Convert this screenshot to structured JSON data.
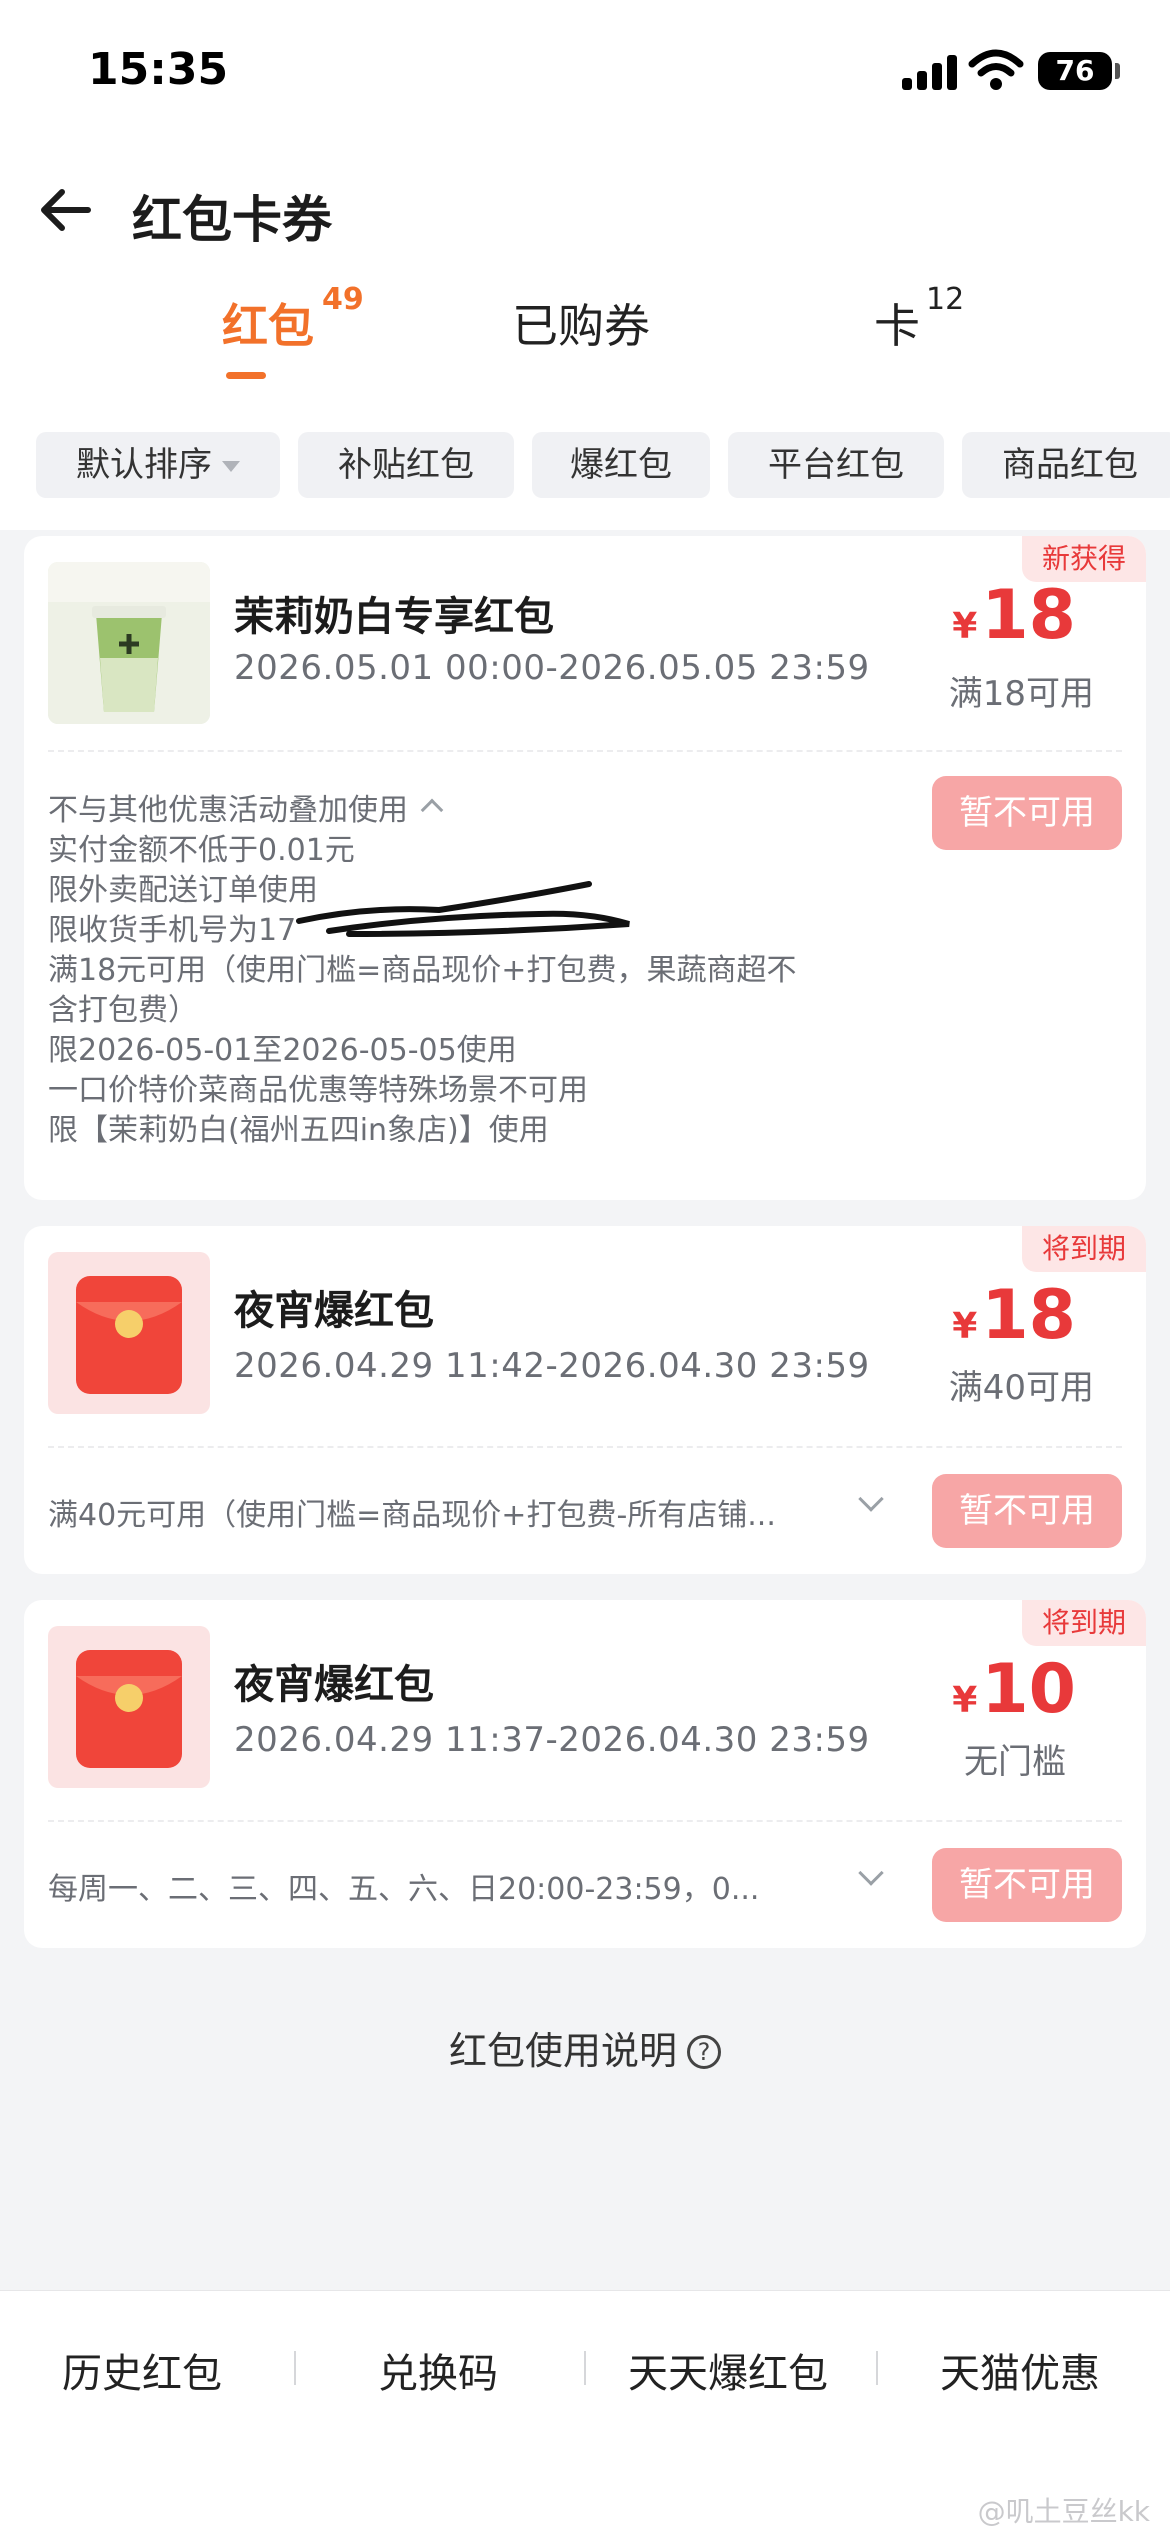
{
  "status_bar": {
    "time": "15:35",
    "battery": "76"
  },
  "nav": {
    "title": "红包卡券"
  },
  "tabs": [
    {
      "label": "红包",
      "count": "49",
      "active": true
    },
    {
      "label": "已购券",
      "count": "",
      "active": false
    },
    {
      "label": "卡",
      "count": "12",
      "active": false
    }
  ],
  "filters": [
    {
      "label": "默认排序",
      "has_caret": true
    },
    {
      "label": "补贴红包"
    },
    {
      "label": "爆红包"
    },
    {
      "label": "平台红包"
    },
    {
      "label": "商品红包"
    }
  ],
  "coupons": [
    {
      "tag": "新获得",
      "title": "茉莉奶白专享红包",
      "date_range": "2026.05.01 00:00-2026.05.05 23:59",
      "currency": "¥",
      "amount": "18",
      "condition": "满18可用",
      "button": "暂不可用",
      "rules": [
        "不与其他优惠活动叠加使用",
        "实付金额不低于0.01元",
        "限外卖配送订单使用",
        "限收货手机号为17",
        "满18元可用（使用门槛=商品现价+打包费，果蔬商超不",
        "含打包费）",
        "限2026-05-01至2026-05-05使用",
        "一口价特价菜商品优惠等特殊场景不可用",
        "限【茉莉奶白(福州五四in象店)】使用"
      ]
    },
    {
      "tag": "将到期",
      "title": "夜宵爆红包",
      "date_range": "2026.04.29 11:42-2026.04.30 23:59",
      "currency": "¥",
      "amount": "18",
      "condition": "满40可用",
      "button": "暂不可用",
      "summary": "满40元可用（使用门槛=商品现价+打包费-所有店铺..."
    },
    {
      "tag": "将到期",
      "title": "夜宵爆红包",
      "date_range": "2026.04.29 11:37-2026.04.30 23:59",
      "currency": "¥",
      "amount": "10",
      "condition": "无门槛",
      "button": "暂不可用",
      "summary": "每周一、二、三、四、五、六、日20:00-23:59，0..."
    }
  ],
  "help": {
    "label": "红包使用说明",
    "icon": "?"
  },
  "bottom": [
    "历史红包",
    "兑换码",
    "天天爆红包",
    "天猫优惠"
  ],
  "watermark": "@叽土豆丝kk",
  "colors": {
    "accent": "#f2712a",
    "price_red": "#e8393a",
    "button_disabled": "#f7a6a6"
  }
}
